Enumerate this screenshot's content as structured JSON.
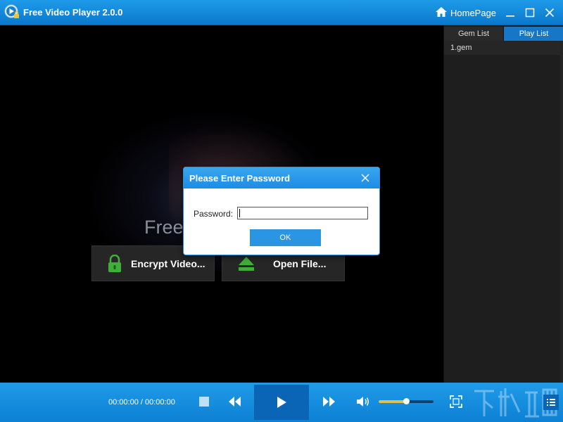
{
  "window": {
    "title": "Free Video Player 2.0.0",
    "homepage_label": "HomePage",
    "icons": {
      "logo": "play-logo-icon",
      "home": "home-icon",
      "minimize": "minimize-icon",
      "maximize": "maximize-icon",
      "close": "close-icon"
    }
  },
  "video": {
    "brand_text": "Free",
    "encrypt_label": "Encrypt Video...",
    "open_label": "Open File...",
    "icons": {
      "encrypt": "lock-icon",
      "open": "eject-icon"
    }
  },
  "sidepanel": {
    "tabs": [
      {
        "label": "Gem List",
        "active": false
      },
      {
        "label": "Play List",
        "active": true
      }
    ],
    "items": [
      {
        "label": "1.gem"
      }
    ]
  },
  "dialog": {
    "title": "Please Enter Password",
    "password_label": "Password:",
    "password_value": "",
    "ok_label": "OK"
  },
  "controls": {
    "time": "00:00:00 / 00:00:00",
    "volume": 0.5,
    "icons": [
      "stop-icon",
      "rewind-icon",
      "play-icon",
      "fast-forward-icon",
      "volume-icon",
      "fullscreen-icon",
      "playlist-icon"
    ]
  },
  "colors": {
    "accent": "#1a8ee0",
    "title_bar": "#0a78cc",
    "play_button": "#0a65b6",
    "active_tab": "#1577c6",
    "volume_fill": "#e2c04c",
    "lock_green": "#3fae3a"
  }
}
